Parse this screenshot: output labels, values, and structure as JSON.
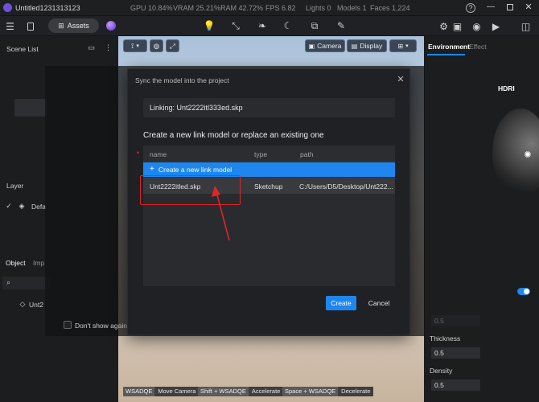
{
  "titlebar": {
    "app_title": "Untitled1231313123",
    "gpu": "GPU 10.84%",
    "vram": "VRAM 25.21%",
    "ram": "RAM 42.72%",
    "fps": "FPS 6.82",
    "lights": "Lights 0",
    "models": "Models 1",
    "faces": "Faces 1,224"
  },
  "toolbar": {
    "assets_label": "Assets"
  },
  "left_panel": {
    "scene_list": "Scene List",
    "layer": "Layer",
    "layer_item": "Defa",
    "tab_object": "Object",
    "tab_import": "Imp",
    "object_item": "Unt2"
  },
  "viewport": {
    "camera_label": "Camera",
    "display_label": "Display"
  },
  "right_panel": {
    "tab_environment": "Environment",
    "tab_effect": "Effect",
    "hdri_label": "HDRI",
    "thickness_label": "Thickness",
    "thickness_value": "0.5",
    "density_label": "Density",
    "density_value": "0.5",
    "upper_value": "0.5"
  },
  "dialog": {
    "title": "Sync the model into the project",
    "linking_text": "Linking: Unt2222itl333ed.skp",
    "section_title": "Create a new link model or replace an existing one",
    "columns": [
      "name",
      "type",
      "path"
    ],
    "create_row_label": "Create a new link model",
    "rows": [
      {
        "name": "Unt2222itled.skp",
        "type": "Sketchup",
        "path": "C:/Users/D5/Desktop/Unt222..."
      }
    ],
    "create_button": "Create",
    "cancel_button": "Cancel",
    "dont_show_again": "Don't show again"
  },
  "hints": [
    {
      "key": "WSADQE",
      "label": "Move Camera"
    },
    {
      "key": "Shift + WSADQE",
      "label": "Accelerate"
    },
    {
      "key": "Space + WSADQE",
      "label": "Decelerate"
    }
  ],
  "colors": {
    "accent": "#1f86ee",
    "highlight_red": "#e0262b"
  }
}
